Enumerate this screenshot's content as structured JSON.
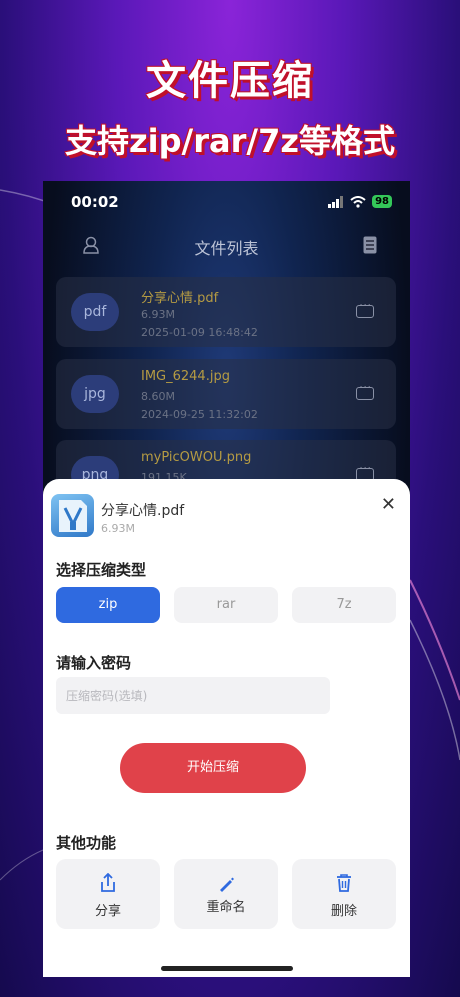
{
  "promo": {
    "title": "文件压缩",
    "subtitle": "支持zip/rar/7z等格式"
  },
  "status_bar": {
    "time": "00:02",
    "battery": "98"
  },
  "header": {
    "title": "文件列表"
  },
  "files": [
    {
      "type": "pdf",
      "name": "分享心情.pdf",
      "size": "6.93M",
      "date": "2025-01-09 16:48:42"
    },
    {
      "type": "jpg",
      "name": "IMG_6244.jpg",
      "size": "8.60M",
      "date": "2024-09-25 11:32:02"
    },
    {
      "type": "png",
      "name": "myPicOWOU.png",
      "size": "191.15K",
      "date": ""
    }
  ],
  "sheet": {
    "file_name": "分享心情.pdf",
    "file_size": "6.93M",
    "type_label": "选择压缩类型",
    "types": [
      "zip",
      "rar",
      "7z"
    ],
    "selected_type": "zip",
    "password_label": "请输入密码",
    "password_placeholder": "压缩密码(选填)",
    "start_button": "开始压缩",
    "other_label": "其他功能",
    "functions": [
      {
        "label": "分享",
        "icon": "share-icon"
      },
      {
        "label": "重命名",
        "icon": "edit-icon"
      },
      {
        "label": "删除",
        "icon": "trash-icon"
      }
    ]
  },
  "colors": {
    "accent": "#2f6ae0",
    "start_button": "#e0424a",
    "filename": "#b59b43"
  }
}
